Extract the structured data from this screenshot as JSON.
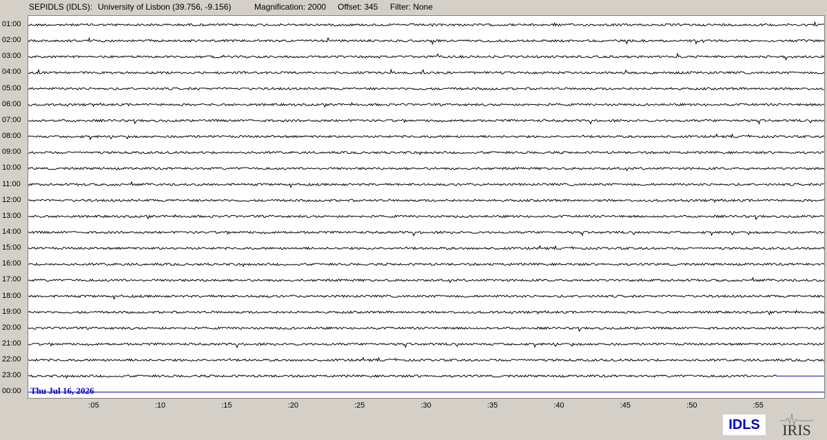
{
  "header": {
    "station": "SEPIDLS (IDLS):",
    "institution": "University of Lisbon (39.756, -9.156)",
    "magnification": "Magnification: 2000",
    "offset": "Offset: 345",
    "filter": "Filter: None"
  },
  "hour_labels": [
    "01:00",
    "02:00",
    "03:00",
    "04:00",
    "05:00",
    "06:00",
    "07:00",
    "08:00",
    "09:00",
    "10:00",
    "11:00",
    "12:00",
    "13:00",
    "14:00",
    "15:00",
    "16:00",
    "17:00",
    "18:00",
    "19:00",
    "20:00",
    "21:00",
    "22:00",
    "23:00",
    "00:00"
  ],
  "minute_labels": [
    ":05",
    ":10",
    ":15",
    ":20",
    ":25",
    ":30",
    ":35",
    ":40",
    ":45",
    ":50",
    ":55"
  ],
  "date_label": "Thu Jul 16, 2026",
  "station_badge": "IDLS",
  "logo_text": "IRIS",
  "colors": {
    "trace": "#000000",
    "current_trace": "#0000cc",
    "date_label": "#0000cc",
    "badge_text": "#0000cc",
    "background": "#d4d0c8",
    "plot_background": "#ffffff"
  },
  "current_row_fraction_recorded": 0.94,
  "icons": {
    "logo": "iris-seismograph-logo-icon"
  }
}
